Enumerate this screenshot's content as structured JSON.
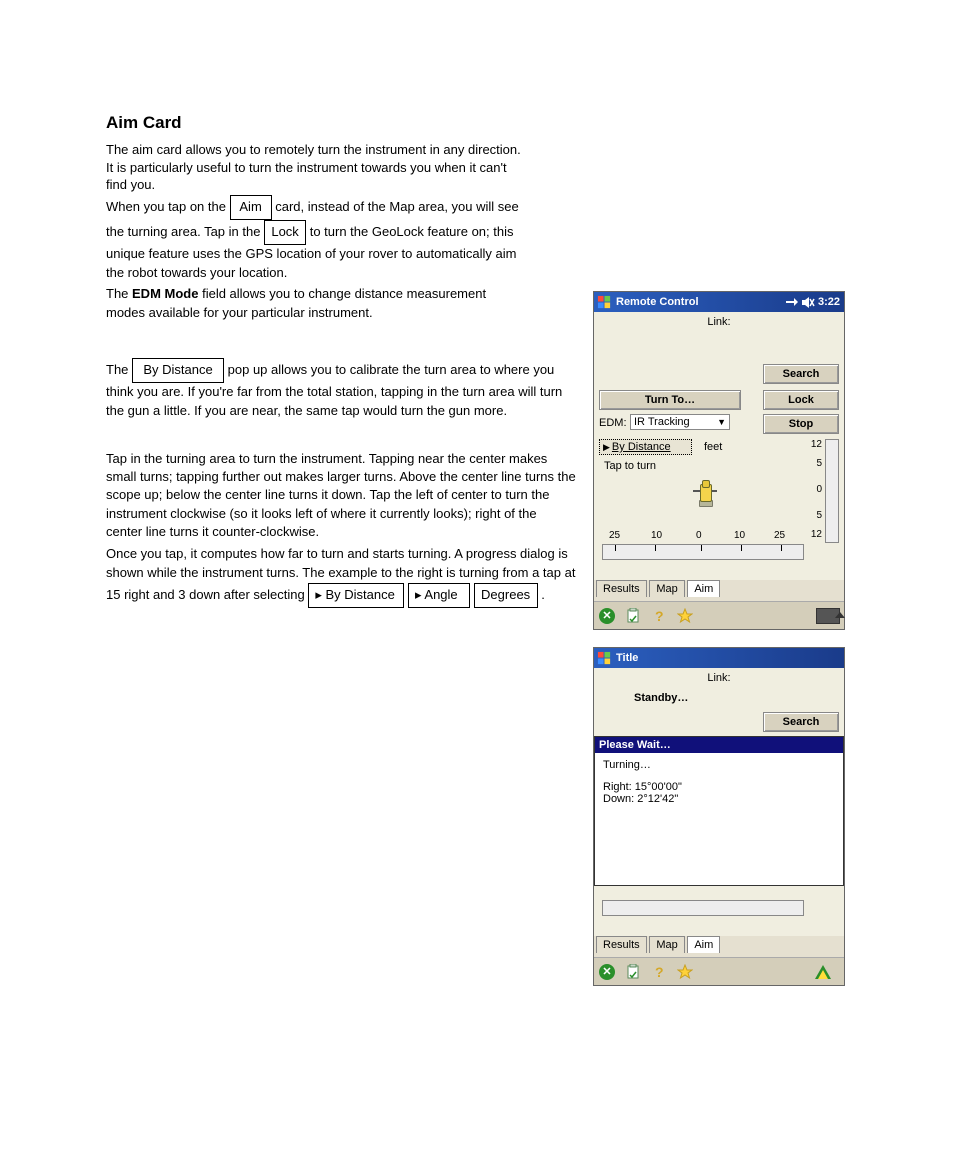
{
  "doc": {
    "heading_aim_card": "Aim Card",
    "para_aim_intro": "The aim card allows you to remotely turn the instrument in any direction. It is particularly useful to turn the instrument towards you when it can't find you.",
    "para_tap1_prefix": "When you tap on the ",
    "btn_aim": "Aim",
    "para_tap1_suffix": " card, instead of the Map area, you will see the turning area.",
    "para_tap2_prefix": "Tap in the ",
    "btn_lock": "Lock",
    "para_tap2_suffix": " to turn the GeoLock feature on; this unique feature uses the GPS location of your rover to automatically aim the robot towards your location.",
    "para_edm_prefix": "The ",
    "label_edm_field": "EDM Mode",
    "para_edm_suffix": " field allows you to change distance measurement modes available for your particular instrument.",
    "para_bydist_prefix": "The ",
    "btn_bydist": "By Distance",
    "para_bydist_suffix": " pop up allows you to calibrate the turn area to where you think you are. If you're far from the total station, tapping in the turn area will turn the gun a little. If you are near, the same tap would turn the gun more.",
    "para_turn": "Tap in the turning area to turn the instrument. Tapping near the center makes small turns; tapping further out makes larger turns. Above the center line turns the scope up; below the center line turns it down. Tap the left of center to turn the instrument clockwise (so it looks left of where it currently looks); right of the center line turns it counter-clockwise.",
    "para_progress_prefix": "Once you tap, it computes how far to turn and starts turning. A progress dialog is shown while the instrument turns. The example to the right is turning from a tap at 15 right and 3 down after selecting ",
    "menu_bydist_tri": "▸ By Distance",
    "menu_angle_tri": "▸ Angle",
    "menu_degrees": "Degrees",
    "para_progress_suffix": "."
  },
  "shot1": {
    "title": "Remote Control",
    "clock": "3:22",
    "link_label": "Link:",
    "btn_search": "Search",
    "btn_turnto": "Turn To…",
    "btn_lock": "Lock",
    "edm_label": "EDM:",
    "edm_value": "IR Tracking",
    "btn_stop": "Stop",
    "bydist_label": "By Distance",
    "units": "feet",
    "tap_hint": "Tap to turn",
    "h_ticks": [
      "25",
      "10",
      "0",
      "10",
      "25"
    ],
    "v_ticks": [
      "12",
      "5",
      "0",
      "5",
      "12"
    ],
    "tabs": {
      "results": "Results",
      "map": "Map",
      "aim": "Aim"
    }
  },
  "shot2": {
    "title": "Title",
    "link_label": "Link:",
    "standby": "Standby…",
    "btn_search": "Search",
    "dlg_header": "Please Wait…",
    "dlg_status": "Turning…",
    "dlg_right": "Right:  15°00'00\"",
    "dlg_down": "Down:  2°12'42\"",
    "tabs": {
      "results": "Results",
      "map": "Map",
      "aim": "Aim"
    }
  }
}
